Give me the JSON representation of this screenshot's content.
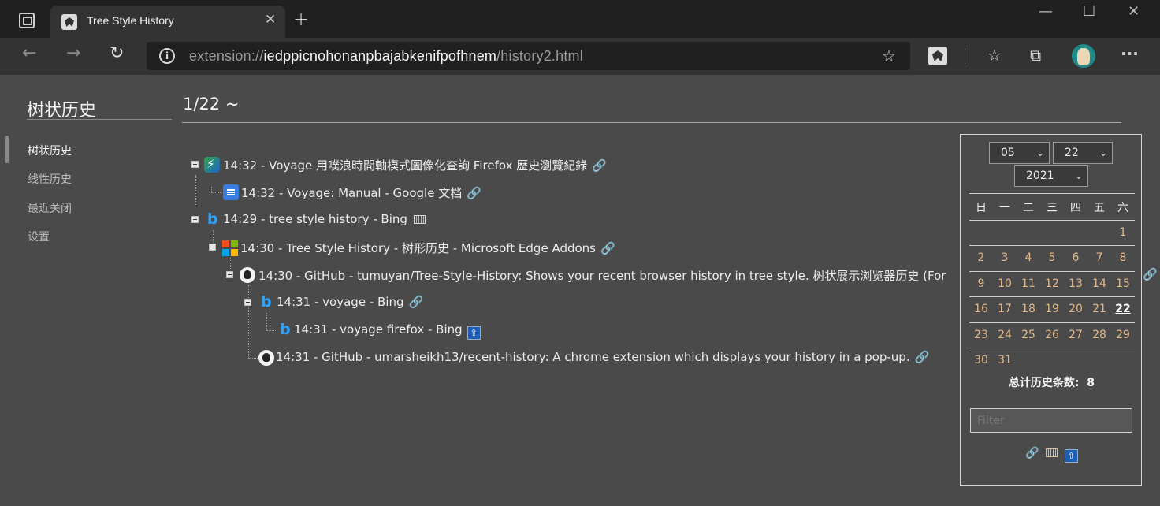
{
  "browser": {
    "tab_title": "Tree Style History",
    "url_scheme": "extension://",
    "url_host": "iedppicnohonanpbajabkenifpofhnem",
    "url_path": "/history2.html",
    "close_glyph": "✕",
    "new_tab_glyph": "+",
    "minimize_glyph": "—",
    "maximize_glyph": "☐",
    "window_close_glyph": "✕",
    "back_glyph": "←",
    "forward_glyph": "→",
    "refresh_glyph": "↻",
    "favorites_glyph": "☆",
    "collections_glyph": "⧉",
    "more_glyph": "···"
  },
  "sidebar": {
    "title": "树状历史",
    "items": [
      {
        "label": "树状历史",
        "active": true
      },
      {
        "label": "线性历史",
        "active": false
      },
      {
        "label": "最近关闭",
        "active": false
      },
      {
        "label": "设置",
        "active": false
      }
    ]
  },
  "main": {
    "date_heading": "1/22 ~",
    "rows": [
      {
        "text": "14:32 - Voyage 用噗浪時間軸模式圖像化查詢 Firefox 歷史瀏覽紀錄",
        "icon": "voyage-icon",
        "badge": "link-icon",
        "badge_glyph": "🔗"
      },
      {
        "text": "14:32 - Voyage: Manual - Google 文档",
        "icon": "google-docs-icon",
        "badge": "link-icon",
        "badge_glyph": "🔗"
      },
      {
        "text": "14:29 - tree style history - Bing",
        "icon": "bing-icon",
        "badge": "keyboard-icon",
        "badge_glyph": ""
      },
      {
        "text": "14:30 - Tree Style History - 树形历史 - Microsoft Edge Addons",
        "icon": "microsoft-icon",
        "badge": "link-icon",
        "badge_glyph": "🔗"
      },
      {
        "text": "14:30 - GitHub - tumuyan/Tree-Style-History: Shows your recent browser history in tree style. 树状展示浏览器历史 (For",
        "icon": "github-icon",
        "badge": "link-icon",
        "badge_glyph": "🔗"
      },
      {
        "text": "14:31 - voyage - Bing",
        "icon": "bing-icon",
        "badge": "link-icon",
        "badge_glyph": "🔗"
      },
      {
        "text": "14:31 - voyage firefox - Bing",
        "icon": "bing-icon",
        "badge": "up-arrow-icon",
        "badge_glyph": "⇧"
      },
      {
        "text": "14:31 - GitHub - umarsheikh13/recent-history: A chrome extension which displays your history in a pop-up.",
        "icon": "github-icon",
        "badge": "link-icon",
        "badge_glyph": "🔗"
      }
    ]
  },
  "calendar": {
    "month": "05",
    "day": "22",
    "year": "2021",
    "weekdays": [
      "日",
      "一",
      "二",
      "三",
      "四",
      "五",
      "六"
    ],
    "weeks": [
      [
        "",
        "",
        "",
        "",
        "",
        "",
        "1"
      ],
      [
        "2",
        "3",
        "4",
        "5",
        "6",
        "7",
        "8"
      ],
      [
        "9",
        "10",
        "11",
        "12",
        "13",
        "14",
        "15"
      ],
      [
        "16",
        "17",
        "18",
        "19",
        "20",
        "21",
        "22"
      ],
      [
        "23",
        "24",
        "25",
        "26",
        "27",
        "28",
        "29"
      ],
      [
        "30",
        "31",
        "",
        "",
        "",
        "",
        ""
      ]
    ],
    "selected_day": "22",
    "total_label": "总计历史条数:",
    "total_count": "8",
    "filter_placeholder": "Filter",
    "legend_link_glyph": "🔗",
    "legend_up_glyph": "⇧"
  },
  "colors": {
    "page_bg": "#4a4a4a",
    "day_text": "#e3b98a",
    "toolbar_bg": "#333333",
    "tabstrip_bg": "#202020"
  }
}
